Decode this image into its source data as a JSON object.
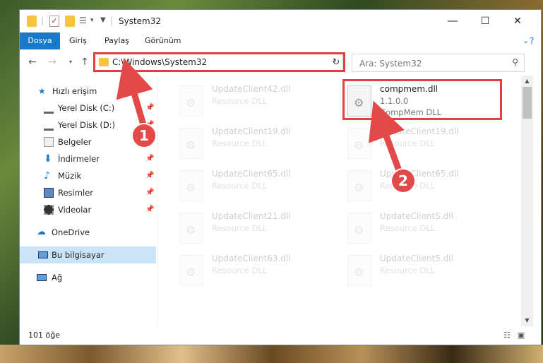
{
  "window": {
    "title": "System32"
  },
  "ribbon": {
    "tabs": [
      "Dosya",
      "Giriş",
      "Paylaş",
      "Görünüm"
    ]
  },
  "nav": {
    "address": "C:\\Windows\\System32",
    "search_placeholder": "Ara: System32"
  },
  "sidebar": {
    "items": [
      {
        "label": "Hızlı erişim",
        "icon": "star-icon"
      },
      {
        "label": "Yerel Disk (C:)",
        "icon": "drive-icon",
        "pinned": true
      },
      {
        "label": "Yerel Disk (D:)",
        "icon": "drive-icon",
        "pinned": true
      },
      {
        "label": "Belgeler",
        "icon": "documents-icon",
        "pinned": true
      },
      {
        "label": "İndirmeler",
        "icon": "download-icon",
        "pinned": true
      },
      {
        "label": "Müzik",
        "icon": "music-icon",
        "pinned": true
      },
      {
        "label": "Resimler",
        "icon": "pictures-icon",
        "pinned": true
      },
      {
        "label": "Videolar",
        "icon": "video-icon",
        "pinned": true
      },
      {
        "label": "OneDrive",
        "icon": "cloud-icon"
      },
      {
        "label": "Bu bilgisayar",
        "icon": "computer-icon",
        "selected": true
      },
      {
        "label": "Ağ",
        "icon": "network-icon"
      }
    ]
  },
  "files": {
    "left": [
      {
        "name": "UpdateClient42.dll",
        "desc": "Resource DLL"
      },
      {
        "name": "UpdateClient19.dll",
        "desc": "Resource DLL"
      },
      {
        "name": "UpdateClient65.dll",
        "desc": "Resource DLL"
      },
      {
        "name": "UpdateClient21.dll",
        "desc": "Resource DLL"
      },
      {
        "name": "UpdateClient63.dll",
        "desc": "Resource DLL"
      }
    ],
    "right_highlight": {
      "name": "compmem.dll",
      "version": "1.1.0.0",
      "desc": "CompMem DLL"
    },
    "right": [
      {
        "name": "UpdateClient19.dll",
        "desc": "Resource DLL"
      },
      {
        "name": "UpdateClient65.dll",
        "desc": "Resource DLL"
      },
      {
        "name": "UpdateClient5.dll",
        "desc": "Resource DLL"
      },
      {
        "name": "UpdateClient5.dll",
        "desc": "Resource DLL"
      }
    ]
  },
  "status": {
    "count": "101 öğe"
  },
  "annotations": {
    "badge1": "1",
    "badge2": "2",
    "color": "#e24a4a"
  }
}
